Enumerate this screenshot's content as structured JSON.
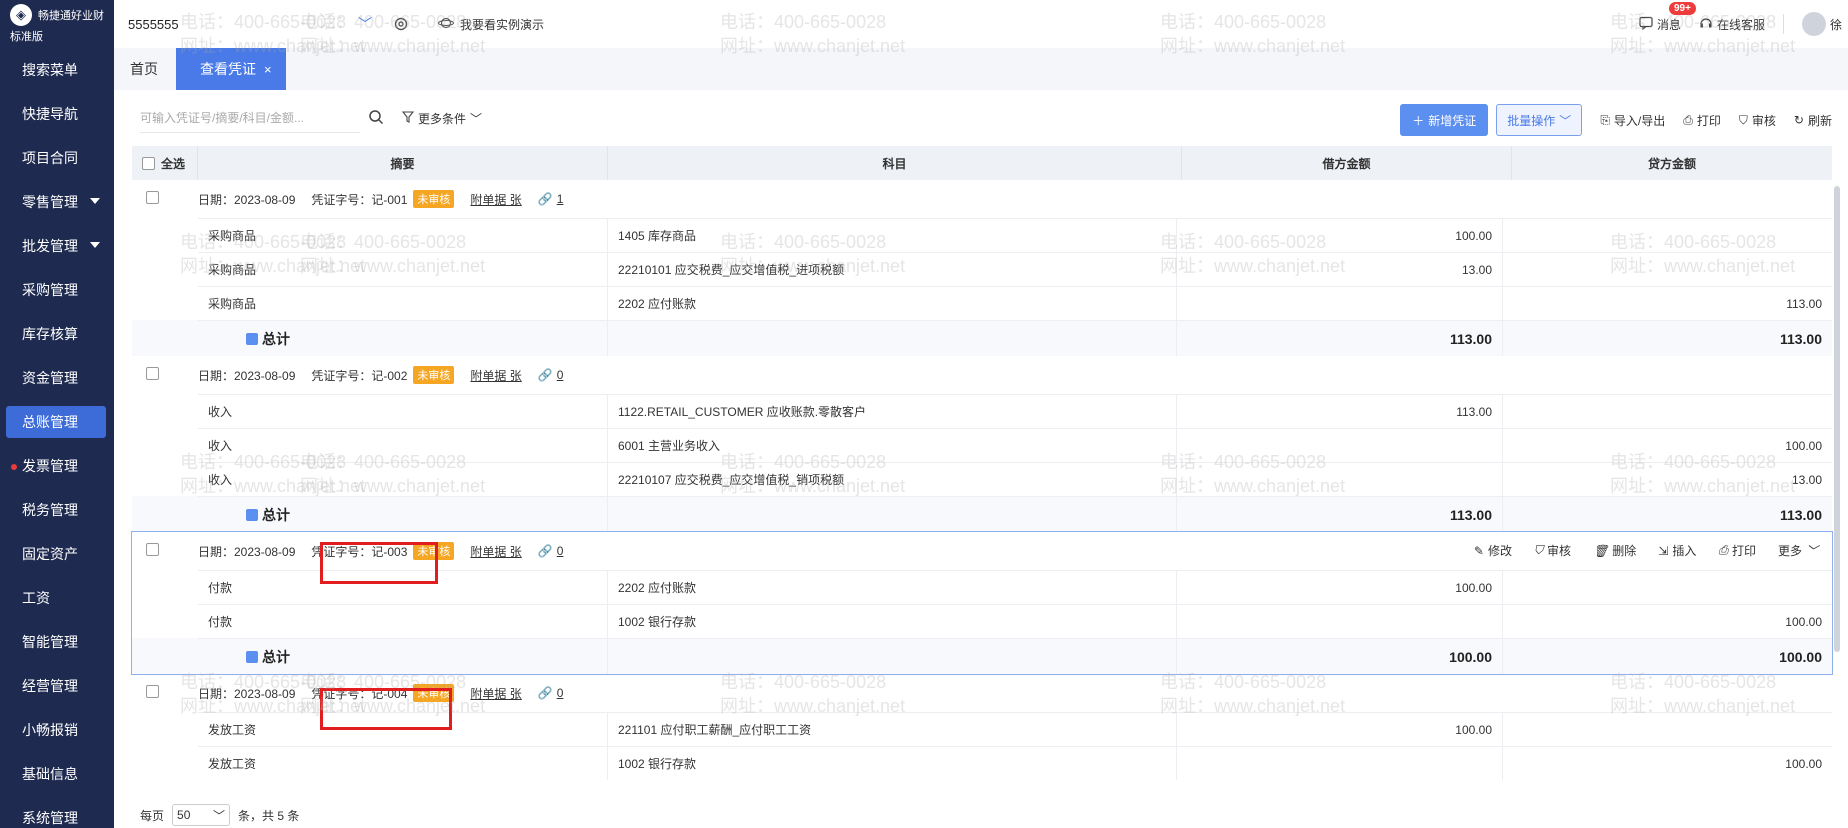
{
  "brand": {
    "name": "畅捷通好业财",
    "edition": "标准版",
    "logo_icon": "chanjet-logo"
  },
  "sidebar": {
    "items": [
      {
        "label": "搜索菜单",
        "caret": false,
        "active": false
      },
      {
        "label": "快捷导航",
        "caret": false,
        "active": false
      },
      {
        "label": "项目合同",
        "caret": false,
        "active": false
      },
      {
        "label": "零售管理",
        "caret": true,
        "active": false
      },
      {
        "label": "批发管理",
        "caret": true,
        "active": false
      },
      {
        "label": "采购管理",
        "caret": false,
        "active": false
      },
      {
        "label": "库存核算",
        "caret": false,
        "active": false
      },
      {
        "label": "资金管理",
        "caret": false,
        "active": false
      },
      {
        "label": "总账管理",
        "caret": false,
        "active": true
      },
      {
        "label": "发票管理",
        "caret": false,
        "active": false,
        "dot": true
      },
      {
        "label": "税务管理",
        "caret": false,
        "active": false
      },
      {
        "label": "固定资产",
        "caret": false,
        "active": false
      },
      {
        "label": "工资",
        "caret": false,
        "active": false
      },
      {
        "label": "智能管理",
        "caret": false,
        "active": false
      },
      {
        "label": "经营管理",
        "caret": false,
        "active": false
      },
      {
        "label": "小畅报销",
        "caret": false,
        "active": false
      },
      {
        "label": "基础信息",
        "caret": false,
        "active": false
      },
      {
        "label": "系统管理",
        "caret": false,
        "active": false
      }
    ]
  },
  "topbar": {
    "company": "5555555",
    "demo_label": "我要看实例演示",
    "messages_label": "消息",
    "messages_badge": "99+",
    "service_label": "在线客服",
    "user_label": "徐"
  },
  "tabs": [
    {
      "label": "首页",
      "active": false
    },
    {
      "label": "查看凭证",
      "active": true,
      "close": "×"
    }
  ],
  "toolbar": {
    "search_placeholder": "可输入凭证号/摘要/科目/金额...",
    "more_conditions": "更多条件",
    "new_voucher": "新增凭证",
    "batch": "批量操作",
    "import_export": "导入/导出",
    "print": "打印",
    "audit": "审核",
    "refresh": "刷新"
  },
  "table": {
    "headers": {
      "select_all": "全选",
      "summary": "摘要",
      "account": "科目",
      "debit": "借方金额",
      "credit": "贷方金额"
    },
    "total_label": "总计",
    "vouchers": [
      {
        "date": "日期：2023-08-09",
        "number": "凭证字号：记-001",
        "status": "未审核",
        "attachment": "附单据 张",
        "link_count": "1",
        "rows": [
          {
            "summary": "采购商品",
            "account": "1405 库存商品",
            "debit": "100.00",
            "credit": ""
          },
          {
            "summary": "采购商品",
            "account": "22210101 应交税费_应交增值税_进项税额",
            "debit": "13.00",
            "credit": ""
          },
          {
            "summary": "采购商品",
            "account": "2202 应付账款",
            "debit": "",
            "credit": "113.00"
          }
        ],
        "total_debit": "113.00",
        "total_credit": "113.00"
      },
      {
        "date": "日期：2023-08-09",
        "number": "凭证字号：记-002",
        "status": "未审核",
        "attachment": "附单据 张",
        "link_count": "0",
        "rows": [
          {
            "summary": "收入",
            "account": "1122.RETAIL_CUSTOMER  应收账款.零散客户",
            "debit": "113.00",
            "credit": ""
          },
          {
            "summary": "收入",
            "account": "6001 主营业务收入",
            "debit": "",
            "credit": "100.00"
          },
          {
            "summary": "收入",
            "account": "22210107 应交税费_应交增值税_销项税额",
            "debit": "",
            "credit": "13.00"
          }
        ],
        "total_debit": "113.00",
        "total_credit": "113.00"
      },
      {
        "date": "日期：2023-08-09",
        "number": "凭证字号：记-003",
        "status": "未审核",
        "attachment": "附单据 张",
        "link_count": "0",
        "actions": {
          "edit": "修改",
          "audit": "审核",
          "delete": "删除",
          "insert": "插入",
          "print": "打印",
          "more": "更多"
        },
        "rows": [
          {
            "summary": "付款",
            "account": "2202 应付账款",
            "debit": "100.00",
            "credit": ""
          },
          {
            "summary": "付款",
            "account": "1002 银行存款",
            "debit": "",
            "credit": "100.00"
          }
        ],
        "total_debit": "100.00",
        "total_credit": "100.00"
      },
      {
        "date": "日期：2023-08-09",
        "number": "凭证字号：记-004",
        "status": "未审核",
        "attachment": "附单据 张",
        "link_count": "0",
        "rows": [
          {
            "summary": "发放工资",
            "account": "221101 应付职工薪酬_应付职工工资",
            "debit": "100.00",
            "credit": ""
          },
          {
            "summary": "发放工资",
            "account": "1002 银行存款",
            "debit": "",
            "credit": "100.00"
          }
        ]
      }
    ]
  },
  "pager": {
    "per_page_label": "每页",
    "per_page_value": "50",
    "total_text": "条，共 5 条"
  },
  "watermark": {
    "phone": "电话：400-665-0028",
    "site": "网址：www.chanjet.net"
  },
  "colors": {
    "sidebar_bg": "#1e2a4f",
    "accent": "#4a7ae8",
    "status_orange": "#f5a623",
    "highlight_red": "#e11d1d"
  }
}
